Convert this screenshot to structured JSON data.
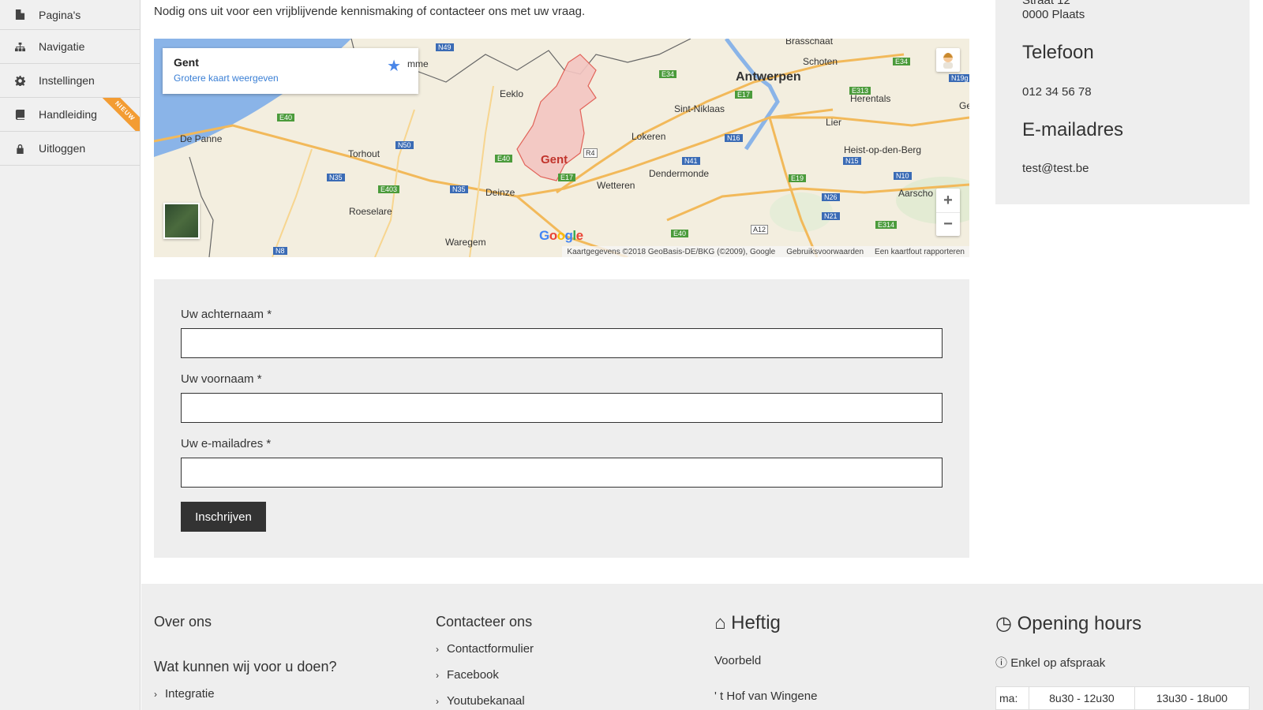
{
  "sidebar": {
    "items": [
      {
        "label": "Pagina's",
        "icon": "file-icon"
      },
      {
        "label": "Navigatie",
        "icon": "sitemap-icon"
      },
      {
        "label": "Instellingen",
        "icon": "gear-icon"
      },
      {
        "label": "Handleiding",
        "icon": "book-icon",
        "badge": "NIEUW"
      },
      {
        "label": "Uitloggen",
        "icon": "lock-icon"
      }
    ]
  },
  "main": {
    "intro": "Nodig ons uit voor een vrijblijvende kennismaking of contacteer ons met uw vraag."
  },
  "map": {
    "place_title": "Gent",
    "larger_map_link": "Grotere kaart weergeven",
    "attribution": "Kaartgegevens ©2018 GeoBasis-DE/BKG (©2009), Google",
    "terms": "Gebruiksvoorwaarden",
    "report": "Een kaartfout rapporteren",
    "logo": "Google",
    "labels": {
      "antwerpen": "Antwerpen",
      "gent": "Gent",
      "brasschaat": "Brasschaat",
      "schoten": "Schoten",
      "eeklo": "Eeklo",
      "sint_niklaas": "Sint-Niklaas",
      "lokeren": "Lokeren",
      "herentals": "Herentals",
      "lier": "Lier",
      "heist": "Heist-op-den-Berg",
      "dendermonde": "Dendermonde",
      "wetteren": "Wetteren",
      "deinze": "Deinze",
      "torhout": "Torhout",
      "roeselare": "Roeselare",
      "waregem": "Waregem",
      "de_panne": "De Panne",
      "aarschot": "Aarscho",
      "mme": "mme",
      "ge": "Ge"
    },
    "roads": {
      "e34a": "E34",
      "e34b": "E34",
      "e17a": "E17",
      "e17b": "E17",
      "e313": "E313",
      "e40a": "E40",
      "e40b": "E40",
      "e40c": "E40",
      "e403": "E403",
      "e19": "E19",
      "e314": "E314",
      "n49": "N49",
      "n50": "N50",
      "n35a": "N35",
      "n35b": "N35",
      "n16": "N16",
      "n41": "N41",
      "n15": "N15",
      "n10": "N10",
      "n26": "N26",
      "n21": "N21",
      "n8": "N8",
      "n19": "N19g",
      "r4": "R4",
      "a12": "A12"
    }
  },
  "form": {
    "lastname_label": "Uw achternaam *",
    "firstname_label": "Uw voornaam *",
    "email_label": "Uw e-mailadres *",
    "lastname_value": "",
    "firstname_value": "",
    "email_value": "",
    "submit_label": "Inschrijven"
  },
  "contact": {
    "street": "Straat 12",
    "city": "0000 Plaats",
    "phone_heading": "Telefoon",
    "phone": "012 34 56 78",
    "email_heading": "E-mailadres",
    "email": "test@test.be"
  },
  "footer": {
    "about_heading": "Over ons",
    "services_heading": "Wat kunnen wij voor u doen?",
    "services": [
      "Integratie"
    ],
    "contact_heading": "Contacteer ons",
    "contact_links": [
      "Contactformulier",
      "Facebook",
      "Youtubekanaal"
    ],
    "company_heading": "Heftig",
    "company_line1": "Voorbeld",
    "company_line2": "' t Hof van Wingene",
    "hours_heading": "Opening hours",
    "hours_note": "Enkel op afspraak",
    "hours_rows": [
      {
        "day": "ma:",
        "morning": "8u30 - 12u30",
        "afternoon": "13u30 - 18u00"
      }
    ]
  },
  "colors": {
    "sidebar_bg": "#f0f0f0",
    "panel_bg": "#eeeeee",
    "button_bg": "#333333",
    "link_blue": "#3a7fd5",
    "ribbon_orange": "#f39c33"
  }
}
